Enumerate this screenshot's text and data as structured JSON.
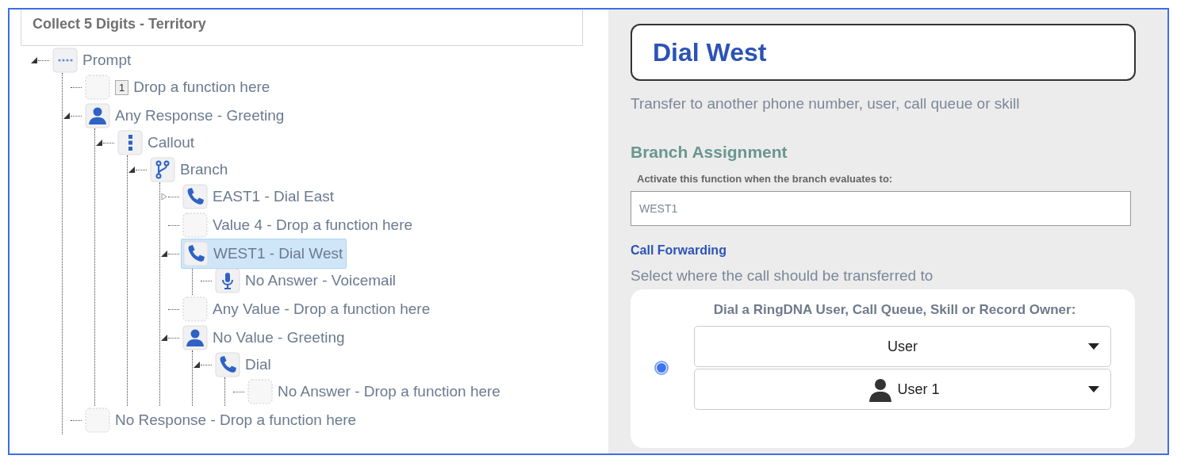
{
  "tree": {
    "title": "Collect 5 Digits - Territory",
    "nodes": [
      {
        "label": "Prompt",
        "kind": "prompt",
        "expanded": true,
        "selected": false,
        "children": [
          {
            "label": "Drop a function here",
            "badge": "1",
            "kind": "empty",
            "selected": false
          },
          {
            "label": "Any Response - Greeting",
            "kind": "person",
            "expanded": true,
            "selected": false,
            "children": [
              {
                "label": "Callout",
                "kind": "callout",
                "expanded": true,
                "selected": false,
                "children": [
                  {
                    "label": "Branch",
                    "kind": "branch",
                    "expanded": true,
                    "selected": false,
                    "children": [
                      {
                        "label": "EAST1 - Dial East",
                        "kind": "phone",
                        "expanded": false,
                        "selected": false
                      },
                      {
                        "label": "Value 4 - Drop a function here",
                        "kind": "empty",
                        "selected": false
                      },
                      {
                        "label": "WEST1 - Dial West",
                        "kind": "phone",
                        "expanded": true,
                        "selected": true,
                        "children": [
                          {
                            "label": "No Answer - Voicemail",
                            "kind": "mic",
                            "selected": false
                          }
                        ]
                      },
                      {
                        "label": "Any Value - Drop a function here",
                        "kind": "empty",
                        "selected": false
                      },
                      {
                        "label": "No Value - Greeting",
                        "kind": "person",
                        "expanded": true,
                        "selected": false,
                        "children": [
                          {
                            "label": "Dial",
                            "kind": "phone",
                            "expanded": true,
                            "selected": false,
                            "children": [
                              {
                                "label": "No Answer - Drop a function here",
                                "kind": "empty",
                                "selected": false
                              }
                            ]
                          }
                        ]
                      }
                    ]
                  }
                ]
              }
            ]
          },
          {
            "label": "No Response - Drop a function here",
            "kind": "empty",
            "selected": false
          }
        ]
      }
    ]
  },
  "panel": {
    "title": "Dial West",
    "description": "Transfer to another phone number, user, call queue or skill",
    "branch_heading": "Branch Assignment",
    "field_label": "Activate this function when the branch evaluates to:",
    "field_value": "WEST1",
    "forwarding_heading": "Call Forwarding",
    "forwarding_description": "Select where the call should be transferred to",
    "option": {
      "heading": "Dial a RingDNA User, Call Queue, Skill or Record Owner:",
      "selected": true,
      "type_value": "User",
      "user_value": "User 1"
    }
  }
}
